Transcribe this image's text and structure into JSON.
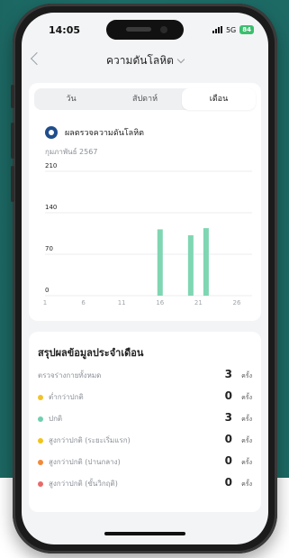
{
  "status": {
    "time": "14:05",
    "network": "5G",
    "battery": "84"
  },
  "nav": {
    "title": "ความดันโลหิต"
  },
  "tabs": [
    {
      "label": "วัน",
      "active": false
    },
    {
      "label": "สัปดาห์",
      "active": false
    },
    {
      "label": "เดือน",
      "active": true
    }
  ],
  "chart_card": {
    "title": "ผลตรวจความดันโลหิต",
    "month": "กุมภาพันธ์ 2567"
  },
  "chart_data": {
    "type": "bar",
    "x": [
      1,
      6,
      11,
      16,
      21,
      26
    ],
    "yticks": [
      0,
      70,
      140,
      210
    ],
    "ylim": [
      0,
      210
    ],
    "xlim": [
      1,
      28
    ],
    "bars": [
      {
        "x": 16,
        "value": 112
      },
      {
        "x": 20,
        "value": 102
      },
      {
        "x": 22,
        "value": 114
      }
    ],
    "bar_color": "#7fd6b2"
  },
  "summary": {
    "title": "สรุปผลข้อมูลประจำเดือน",
    "unit": "ครั้ง",
    "rows": [
      {
        "label": "ตรวจร่างกายทั้งหมด",
        "value": "3",
        "color": ""
      },
      {
        "label": "ต่ำกว่าปกติ",
        "value": "0",
        "color": "#f2c22d"
      },
      {
        "label": "ปกติ",
        "value": "3",
        "color": "#6fcfb0"
      },
      {
        "label": "สูงกว่าปกติ (ระยะเริ่มแรก)",
        "value": "0",
        "color": "#f0c419"
      },
      {
        "label": "สูงกว่าปกติ (ปานกลาง)",
        "value": "0",
        "color": "#f08a3a"
      },
      {
        "label": "สูงกว่าปกติ (ขั้นวิกฤติ)",
        "value": "0",
        "color": "#e86a6a"
      }
    ]
  }
}
